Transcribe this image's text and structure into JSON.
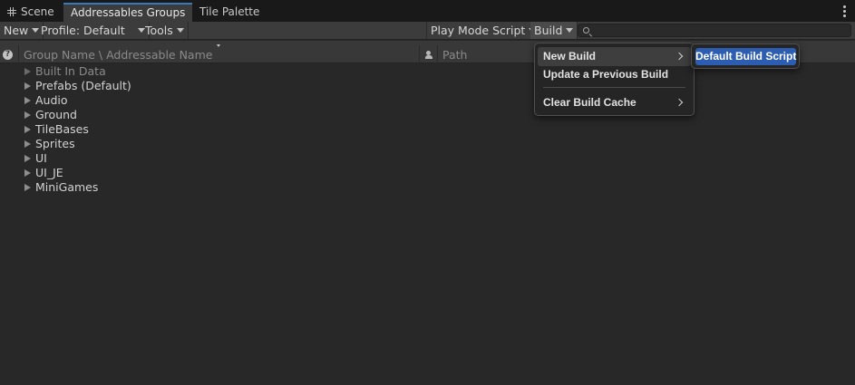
{
  "tabs": [
    {
      "label": "Scene",
      "icon": "grid-icon"
    },
    {
      "label": "Addressables Groups",
      "active": true
    },
    {
      "label": "Tile Palette"
    }
  ],
  "toolbar": {
    "new_label": "New",
    "profile_label": "Profile: Default",
    "tools_label": "Tools",
    "play_mode_label": "Play Mode Script",
    "build_label": "Build",
    "search": {
      "value": "",
      "placeholder": ""
    }
  },
  "columns": {
    "name_header": "Group Name \\ Addressable Name",
    "path_header": "Path"
  },
  "groups": [
    {
      "label": "Built In Data",
      "dimmed": true
    },
    {
      "label": "Prefabs (Default)"
    },
    {
      "label": "Audio"
    },
    {
      "label": "Ground"
    },
    {
      "label": "TileBases"
    },
    {
      "label": "Sprites"
    },
    {
      "label": "UI"
    },
    {
      "label": "UI_JE"
    },
    {
      "label": "MiniGames"
    }
  ],
  "build_menu": {
    "items": [
      {
        "label": "New Build",
        "has_submenu": true,
        "highlighted": true
      },
      {
        "label": "Update a Previous Build"
      },
      {
        "label": "Clear Build Cache",
        "has_submenu": true
      }
    ],
    "submenu": {
      "items": [
        {
          "label": "Default Build Script",
          "selected": true
        }
      ]
    }
  },
  "colors": {
    "accent": "#2c5db0",
    "tab_highlight": "#3a79bb",
    "background": "#282828"
  }
}
